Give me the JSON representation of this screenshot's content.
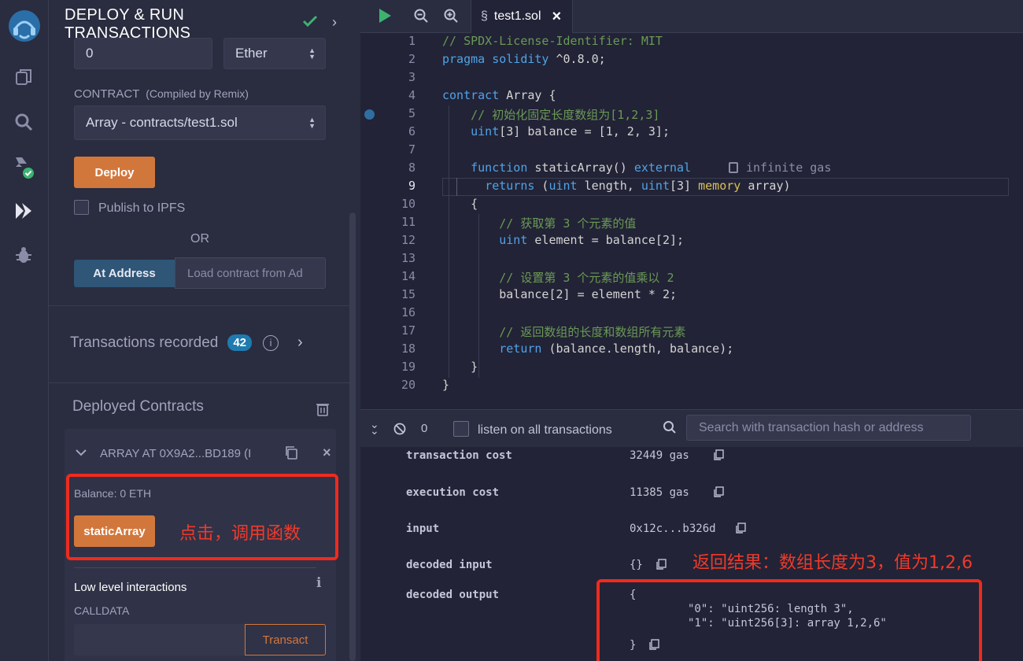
{
  "iconbar": {
    "items": [
      "remix-logo",
      "files-icon",
      "search-icon",
      "compiler-icon",
      "deploy-icon",
      "debugger-icon"
    ]
  },
  "panel": {
    "title_line1": "DEPLOY & RUN",
    "title_line2": "TRANSACTIONS",
    "value_input": "0",
    "value_unit": "Ether",
    "contract_label": "CONTRACT",
    "contract_label_sub": "(Compiled by Remix)",
    "contract_select": "Array - contracts/test1.sol",
    "deploy_label": "Deploy",
    "publish_label": "Publish to IPFS",
    "or_label": "OR",
    "at_address_label": "At Address",
    "load_placeholder": "Load contract from Ad",
    "transactions_recorded": "Transactions recorded",
    "transactions_count": "42",
    "deployed_contracts": "Deployed Contracts",
    "instance_name": "ARRAY AT 0X9A2...BD189 (I",
    "balance": "Balance: 0 ETH",
    "static_array_label": "staticArray",
    "low_level": "Low level interactions",
    "calldata": "CALLDATA",
    "transact_label": "Transact"
  },
  "editor": {
    "tab_name": "test1.sol",
    "active_line": 9,
    "lines": [
      {
        "n": "1",
        "code": "// SPDX-License-Identifier: MIT"
      },
      {
        "n": "2",
        "code": "pragma solidity ^0.8.0;"
      },
      {
        "n": "3",
        "code": ""
      },
      {
        "n": "4",
        "code": "contract Array {"
      },
      {
        "n": "5",
        "code": "    // 初始化固定长度数组为[1,2,3]"
      },
      {
        "n": "6",
        "code": "    uint[3] balance = [1, 2, 3];"
      },
      {
        "n": "7",
        "code": ""
      },
      {
        "n": "8",
        "code": "    function staticArray() external"
      },
      {
        "n": "9",
        "code": "      returns (uint length, uint[3] memory array)"
      },
      {
        "n": "10",
        "code": "    {"
      },
      {
        "n": "11",
        "code": "        // 获取第 3 个元素的值"
      },
      {
        "n": "12",
        "code": "        uint element = balance[2];"
      },
      {
        "n": "13",
        "code": ""
      },
      {
        "n": "14",
        "code": "        // 设置第 3 个元素的值乘以 2"
      },
      {
        "n": "15",
        "code": "        balance[2] = element * 2;"
      },
      {
        "n": "16",
        "code": ""
      },
      {
        "n": "17",
        "code": "        // 返回数组的长度和数组所有元素"
      },
      {
        "n": "18",
        "code": "        return (balance.length, balance);"
      },
      {
        "n": "19",
        "code": "    }"
      },
      {
        "n": "20",
        "code": "}"
      }
    ],
    "gas_hint": "infinite gas"
  },
  "terminal": {
    "count": "0",
    "listen_label": "listen on all transactions",
    "search_placeholder": "Search with transaction hash or address",
    "rows": [
      {
        "key": "transaction cost",
        "value": "32449 gas"
      },
      {
        "key": "execution cost",
        "value": "11385 gas"
      },
      {
        "key": "input",
        "value": "0x12c...b326d"
      },
      {
        "key": "decoded input",
        "value": "{}"
      },
      {
        "key": "decoded output",
        "value": "{"
      }
    ],
    "output_line1": "\"0\": \"uint256: length 3\",",
    "output_line2": "\"1\": \"uint256[3]: array 1,2,6\"",
    "output_close": "}"
  },
  "annotations": {
    "click_hint": "点击，调用函数",
    "result_hint": "返回结果：数组长度为3，值为1,2,6"
  },
  "colors": {
    "accent": "#d2773c",
    "badge": "#1f7aaf",
    "annotation": "#f02a1d"
  }
}
